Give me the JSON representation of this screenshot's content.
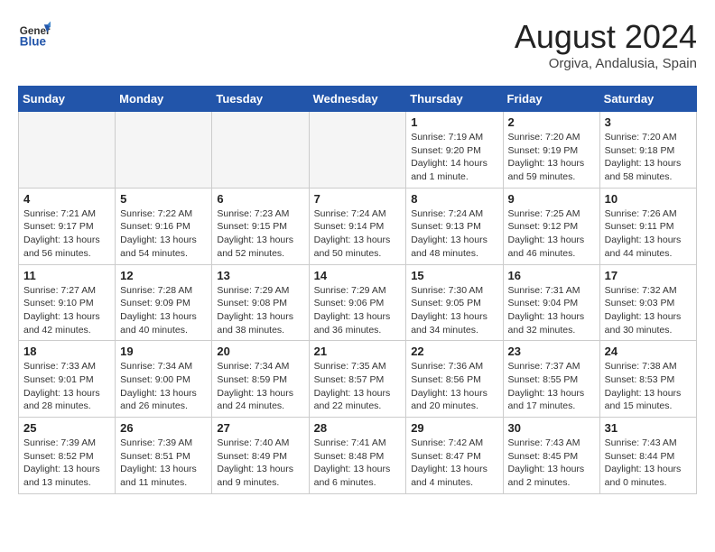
{
  "header": {
    "logo": "GeneralBlue",
    "month_year": "August 2024",
    "location": "Orgiva, Andalusia, Spain"
  },
  "weekdays": [
    "Sunday",
    "Monday",
    "Tuesday",
    "Wednesday",
    "Thursday",
    "Friday",
    "Saturday"
  ],
  "weeks": [
    [
      {
        "day": "",
        "info": ""
      },
      {
        "day": "",
        "info": ""
      },
      {
        "day": "",
        "info": ""
      },
      {
        "day": "",
        "info": ""
      },
      {
        "day": "1",
        "info": "Sunrise: 7:19 AM\nSunset: 9:20 PM\nDaylight: 14 hours\nand 1 minute."
      },
      {
        "day": "2",
        "info": "Sunrise: 7:20 AM\nSunset: 9:19 PM\nDaylight: 13 hours\nand 59 minutes."
      },
      {
        "day": "3",
        "info": "Sunrise: 7:20 AM\nSunset: 9:18 PM\nDaylight: 13 hours\nand 58 minutes."
      }
    ],
    [
      {
        "day": "4",
        "info": "Sunrise: 7:21 AM\nSunset: 9:17 PM\nDaylight: 13 hours\nand 56 minutes."
      },
      {
        "day": "5",
        "info": "Sunrise: 7:22 AM\nSunset: 9:16 PM\nDaylight: 13 hours\nand 54 minutes."
      },
      {
        "day": "6",
        "info": "Sunrise: 7:23 AM\nSunset: 9:15 PM\nDaylight: 13 hours\nand 52 minutes."
      },
      {
        "day": "7",
        "info": "Sunrise: 7:24 AM\nSunset: 9:14 PM\nDaylight: 13 hours\nand 50 minutes."
      },
      {
        "day": "8",
        "info": "Sunrise: 7:24 AM\nSunset: 9:13 PM\nDaylight: 13 hours\nand 48 minutes."
      },
      {
        "day": "9",
        "info": "Sunrise: 7:25 AM\nSunset: 9:12 PM\nDaylight: 13 hours\nand 46 minutes."
      },
      {
        "day": "10",
        "info": "Sunrise: 7:26 AM\nSunset: 9:11 PM\nDaylight: 13 hours\nand 44 minutes."
      }
    ],
    [
      {
        "day": "11",
        "info": "Sunrise: 7:27 AM\nSunset: 9:10 PM\nDaylight: 13 hours\nand 42 minutes."
      },
      {
        "day": "12",
        "info": "Sunrise: 7:28 AM\nSunset: 9:09 PM\nDaylight: 13 hours\nand 40 minutes."
      },
      {
        "day": "13",
        "info": "Sunrise: 7:29 AM\nSunset: 9:08 PM\nDaylight: 13 hours\nand 38 minutes."
      },
      {
        "day": "14",
        "info": "Sunrise: 7:29 AM\nSunset: 9:06 PM\nDaylight: 13 hours\nand 36 minutes."
      },
      {
        "day": "15",
        "info": "Sunrise: 7:30 AM\nSunset: 9:05 PM\nDaylight: 13 hours\nand 34 minutes."
      },
      {
        "day": "16",
        "info": "Sunrise: 7:31 AM\nSunset: 9:04 PM\nDaylight: 13 hours\nand 32 minutes."
      },
      {
        "day": "17",
        "info": "Sunrise: 7:32 AM\nSunset: 9:03 PM\nDaylight: 13 hours\nand 30 minutes."
      }
    ],
    [
      {
        "day": "18",
        "info": "Sunrise: 7:33 AM\nSunset: 9:01 PM\nDaylight: 13 hours\nand 28 minutes."
      },
      {
        "day": "19",
        "info": "Sunrise: 7:34 AM\nSunset: 9:00 PM\nDaylight: 13 hours\nand 26 minutes."
      },
      {
        "day": "20",
        "info": "Sunrise: 7:34 AM\nSunset: 8:59 PM\nDaylight: 13 hours\nand 24 minutes."
      },
      {
        "day": "21",
        "info": "Sunrise: 7:35 AM\nSunset: 8:57 PM\nDaylight: 13 hours\nand 22 minutes."
      },
      {
        "day": "22",
        "info": "Sunrise: 7:36 AM\nSunset: 8:56 PM\nDaylight: 13 hours\nand 20 minutes."
      },
      {
        "day": "23",
        "info": "Sunrise: 7:37 AM\nSunset: 8:55 PM\nDaylight: 13 hours\nand 17 minutes."
      },
      {
        "day": "24",
        "info": "Sunrise: 7:38 AM\nSunset: 8:53 PM\nDaylight: 13 hours\nand 15 minutes."
      }
    ],
    [
      {
        "day": "25",
        "info": "Sunrise: 7:39 AM\nSunset: 8:52 PM\nDaylight: 13 hours\nand 13 minutes."
      },
      {
        "day": "26",
        "info": "Sunrise: 7:39 AM\nSunset: 8:51 PM\nDaylight: 13 hours\nand 11 minutes."
      },
      {
        "day": "27",
        "info": "Sunrise: 7:40 AM\nSunset: 8:49 PM\nDaylight: 13 hours\nand 9 minutes."
      },
      {
        "day": "28",
        "info": "Sunrise: 7:41 AM\nSunset: 8:48 PM\nDaylight: 13 hours\nand 6 minutes."
      },
      {
        "day": "29",
        "info": "Sunrise: 7:42 AM\nSunset: 8:47 PM\nDaylight: 13 hours\nand 4 minutes."
      },
      {
        "day": "30",
        "info": "Sunrise: 7:43 AM\nSunset: 8:45 PM\nDaylight: 13 hours\nand 2 minutes."
      },
      {
        "day": "31",
        "info": "Sunrise: 7:43 AM\nSunset: 8:44 PM\nDaylight: 13 hours\nand 0 minutes."
      }
    ]
  ]
}
